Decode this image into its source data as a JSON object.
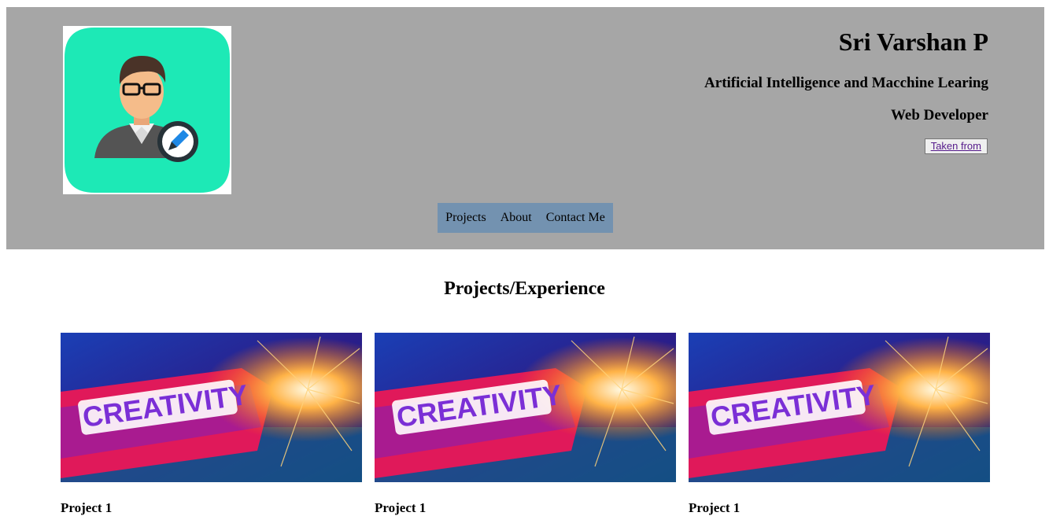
{
  "header": {
    "name": "Sri Varshan P",
    "role_primary": "Artificial Intelligence and Macchine Learing",
    "role_secondary": "Web Developer",
    "credit_button": "Taken from",
    "avatar_icon": "user-profile-edit-icon",
    "background_color": "#a6a6a6",
    "avatar_tile_color": "#1de9b6"
  },
  "nav": {
    "background_color": "#7392b0",
    "items": [
      {
        "label": "Projects"
      },
      {
        "label": "About"
      },
      {
        "label": "Contact Me"
      }
    ]
  },
  "projects": {
    "title": "Projects/Experience",
    "cards": [
      {
        "image_text": "CREATIVITY",
        "caption": "Project 1"
      },
      {
        "image_text": "CREATIVITY",
        "caption": "Project 1"
      },
      {
        "image_text": "CREATIVITY",
        "caption": "Project 1"
      }
    ]
  }
}
